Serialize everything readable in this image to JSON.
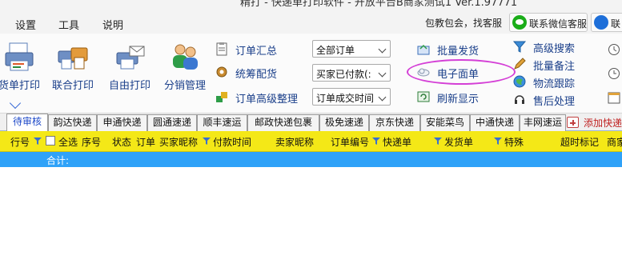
{
  "window": {
    "title": "精打 - 快递单打印软件 - 开放平台B商家测试1 Ver.1.97771"
  },
  "menu": {
    "items": [
      "设置",
      "工具",
      "说明"
    ],
    "promo": "包教包会，找客服",
    "wechat_service": "联系微信客服",
    "contact": "联"
  },
  "ribbon": {
    "big_buttons": [
      "货单打印",
      "联合打印",
      "自由打印",
      "分销管理"
    ],
    "order_tools": [
      "订单汇总",
      "统筹配货",
      "订单高级整理"
    ],
    "filters": [
      "全部订单",
      "买家已付款(:",
      "订单成交时间"
    ],
    "ship_tools": [
      "批量发货",
      "电子面单",
      "刷新显示"
    ],
    "extra_tools": [
      "高级搜索",
      "批量备注",
      "物流跟踪",
      "售后处理"
    ]
  },
  "tabs": {
    "items": [
      "待审核",
      "韵达快递",
      "申通快递",
      "圆通速递",
      "顺丰速运",
      "邮政快递包裹",
      "极免速递",
      "京东快递",
      "安能菜鸟",
      "中通快递",
      "丰网速运"
    ],
    "active": 0,
    "add_label": "添加快递"
  },
  "grid": {
    "columns": [
      "行号",
      "全选",
      "序号",
      "状态",
      "订单",
      "买家昵称",
      "付款时间",
      "卖家昵称",
      "订单编号",
      "快递单",
      "发货单",
      "特殊",
      "超时标记",
      "商家"
    ],
    "total_label": "合计:"
  },
  "colors": {
    "header_bg": "#f4e817",
    "sum_row_bg": "#2fa2f8",
    "active_tab_text": "#1e49c8",
    "annotation": "#d43fd6"
  },
  "icons": {
    "funnel": "funnel-icon",
    "printer": "printer-icon",
    "gear": "gear-icon",
    "wechat": "wechat-icon",
    "plus": "plus-icon"
  }
}
